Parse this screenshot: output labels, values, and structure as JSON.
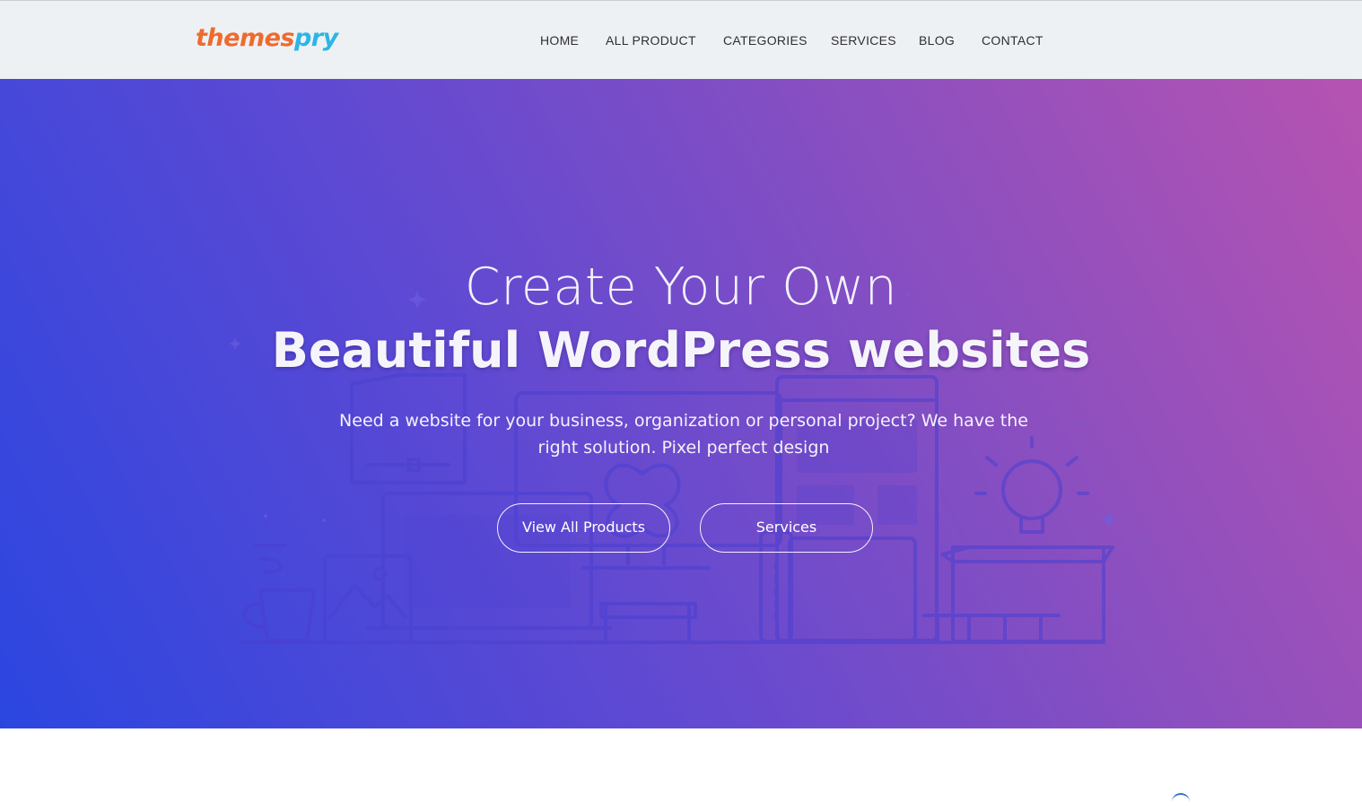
{
  "header": {
    "logo": {
      "part1": "themes",
      "part2": "pry",
      "color1": "#ef6a2e",
      "color2": "#2bb6e6"
    },
    "nav": [
      "HOME",
      "ALL PRODUCT",
      "CATEGORIES",
      "SERVICES",
      "BLOG",
      "CONTACT"
    ]
  },
  "hero": {
    "title_line1": "Create Your Own",
    "title_line2": "Beautiful WordPress websites",
    "subtitle": "Need a website for your business, organization or personal project? We have the right solution. Pixel perfect design",
    "buttons": {
      "primary": "View All Products",
      "secondary": "Services"
    },
    "gradient": [
      "#2b46e0",
      "#5e49d3",
      "#8b4fc0",
      "#b653b1"
    ]
  }
}
